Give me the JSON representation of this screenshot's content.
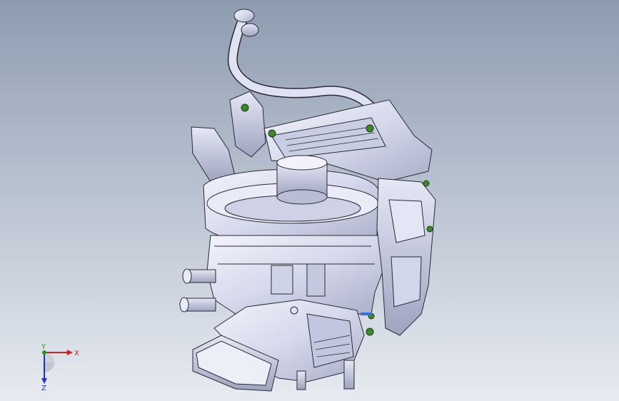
{
  "viewport": {
    "background_top": "#8e9cb0",
    "background_bottom": "#e7ebf1"
  },
  "model": {
    "description_icon": "cad-hvac-assembly",
    "body_color": "#d9dcef",
    "edge_color": "#2a2a33",
    "fastener_color": "#3a8a2a"
  },
  "triad": {
    "x_label": "X",
    "y_label": "Y",
    "z_label": "Z",
    "x_color": "#d42020",
    "y_color": "#1aa01a",
    "z_color": "#2030c8"
  }
}
